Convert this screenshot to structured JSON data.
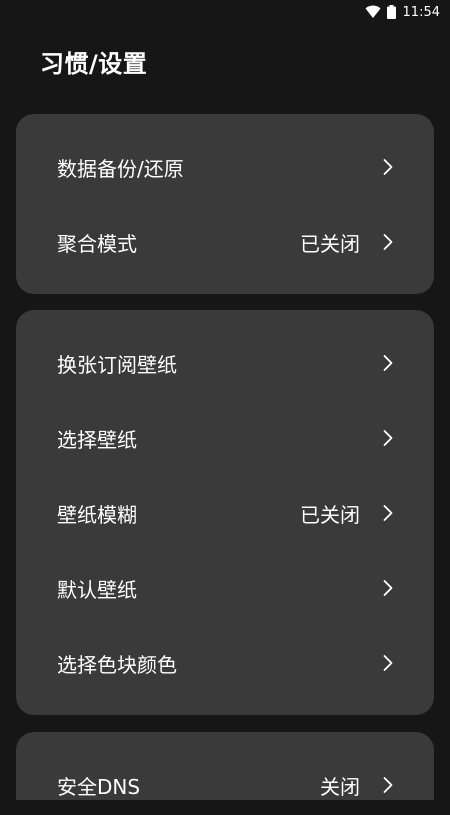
{
  "status_bar": {
    "time": "11:54",
    "icons": [
      "wifi-icon",
      "battery-icon"
    ]
  },
  "page": {
    "title": "习惯/设置"
  },
  "sections": [
    {
      "items": [
        {
          "label": "数据备份/还原",
          "value": "",
          "icon": "chevron-right-icon"
        },
        {
          "label": "聚合模式",
          "value": "已关闭",
          "icon": "chevron-right-icon"
        }
      ]
    },
    {
      "items": [
        {
          "label": "换张订阅壁纸",
          "value": "",
          "icon": "chevron-right-icon"
        },
        {
          "label": "选择壁纸",
          "value": "",
          "icon": "chevron-right-icon"
        },
        {
          "label": "壁纸模糊",
          "value": "已关闭",
          "icon": "chevron-right-icon"
        },
        {
          "label": "默认壁纸",
          "value": "",
          "icon": "chevron-right-icon"
        },
        {
          "label": "选择色块颜色",
          "value": "",
          "icon": "chevron-right-icon"
        }
      ]
    },
    {
      "items": [
        {
          "label": "安全DNS",
          "value": "关闭",
          "icon": "chevron-right-icon"
        }
      ]
    }
  ],
  "colors": {
    "background": "#161616",
    "card": "#3a3a3a",
    "text": "#ffffff"
  }
}
